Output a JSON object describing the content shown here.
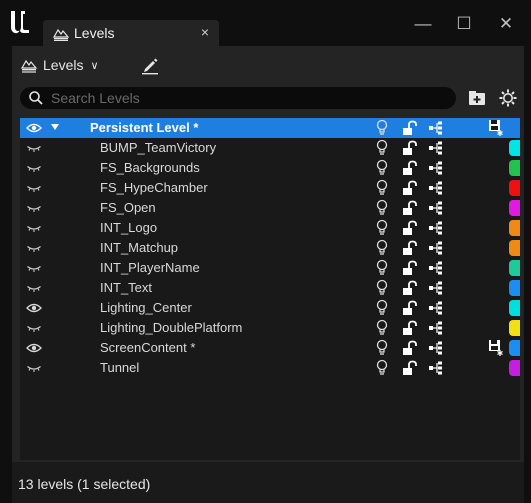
{
  "window": {
    "tab_title": "Levels",
    "tab_close": "×",
    "minimize": "—",
    "maximize": "☐",
    "close": "✕"
  },
  "toolbar": {
    "levels_label": "Levels",
    "levels_icon": "levels-stack-icon",
    "edit_icon": "pencil-edit-icon"
  },
  "search": {
    "placeholder": "Search Levels",
    "value": ""
  },
  "colors": {
    "selected_row": "#1e7fe0",
    "panel_bg": "#242424",
    "list_bg": "#191919"
  },
  "levels": [
    {
      "name": "Persistent Level *",
      "visible": true,
      "selected": true,
      "persistent": true,
      "modified": true,
      "color": null
    },
    {
      "name": "BUMP_TeamVictory",
      "visible": false,
      "selected": false,
      "persistent": false,
      "modified": false,
      "color": "#00e5e5"
    },
    {
      "name": "FS_Backgrounds",
      "visible": false,
      "selected": false,
      "persistent": false,
      "modified": false,
      "color": "#23c24f"
    },
    {
      "name": "FS_HypeChamber",
      "visible": false,
      "selected": false,
      "persistent": false,
      "modified": false,
      "color": "#ee1111"
    },
    {
      "name": "FS_Open",
      "visible": false,
      "selected": false,
      "persistent": false,
      "modified": false,
      "color": "#e01adf"
    },
    {
      "name": "INT_Logo",
      "visible": false,
      "selected": false,
      "persistent": false,
      "modified": false,
      "color": "#f08a14"
    },
    {
      "name": "INT_Matchup",
      "visible": false,
      "selected": false,
      "persistent": false,
      "modified": false,
      "color": "#f08a14"
    },
    {
      "name": "INT_PlayerName",
      "visible": false,
      "selected": false,
      "persistent": false,
      "modified": false,
      "color": "#1ec99b"
    },
    {
      "name": "INT_Text",
      "visible": false,
      "selected": false,
      "persistent": false,
      "modified": false,
      "color": "#1c8ef2"
    },
    {
      "name": "Lighting_Center",
      "visible": true,
      "selected": false,
      "persistent": false,
      "modified": false,
      "color": "#00dede"
    },
    {
      "name": "Lighting_DoublePlatform",
      "visible": false,
      "selected": false,
      "persistent": false,
      "modified": false,
      "color": "#f0e014"
    },
    {
      "name": "ScreenContent *",
      "visible": true,
      "selected": false,
      "persistent": false,
      "modified": true,
      "color": "#1c8ef2"
    },
    {
      "name": "Tunnel",
      "visible": false,
      "selected": false,
      "persistent": false,
      "modified": false,
      "color": "#c41ee0"
    }
  ],
  "status": {
    "text": "13 levels (1 selected)"
  }
}
